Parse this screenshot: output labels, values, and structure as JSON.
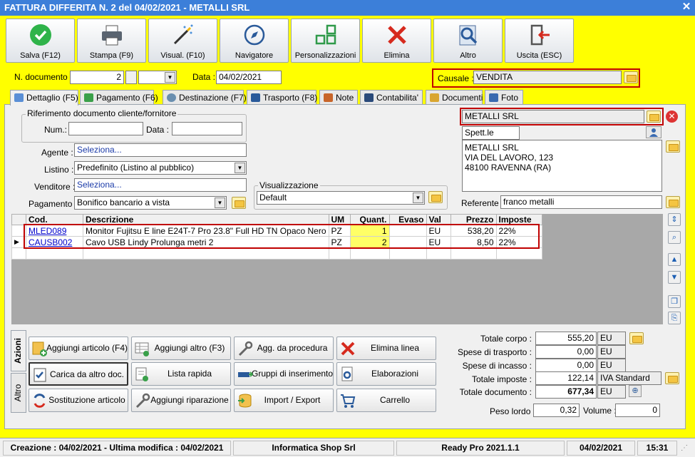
{
  "window": {
    "title": "FATTURA DIFFERITA N. 2 del 04/02/2021 - METALLI SRL",
    "close": "✕"
  },
  "toolbar": [
    {
      "label": "Salva (F12)",
      "icon": "save-check-icon"
    },
    {
      "label": "Stampa (F9)",
      "icon": "printer-icon"
    },
    {
      "label": "Visual. (F10)",
      "icon": "magic-wand-icon"
    },
    {
      "label": "Navigatore",
      "icon": "compass-icon"
    },
    {
      "label": "Personalizzazioni",
      "icon": "grid-icon"
    },
    {
      "label": "Elimina",
      "icon": "delete-x-icon"
    },
    {
      "label": "Altro",
      "icon": "magnifier-icon"
    },
    {
      "label": "Uscita (ESC)",
      "icon": "exit-door-icon"
    }
  ],
  "header": {
    "ndoc_label": "N. documento :",
    "ndoc_value": "2",
    "data_label": "Data :",
    "data_value": "04/02/2021",
    "causale_label": "Causale :",
    "causale_value": "VENDITA"
  },
  "tabs": [
    "Dettaglio (F5)",
    "Pagamento (F6)",
    "Destinazione (F7)",
    "Trasporto (F8)",
    "Note",
    "Contabilita'",
    "Documenti",
    "Foto"
  ],
  "form": {
    "rif_title": "Riferimento documento cliente/fornitore",
    "num_label": "Num.:",
    "data_label": "Data :",
    "agente_label": "Agente :",
    "agente_value": "Seleziona...",
    "listino_label": "Listino :",
    "listino_value": "Predefinito (Listino al pubblico)",
    "venditore_label": "Venditore :",
    "venditore_value": "Seleziona...",
    "pagamento_label": "Pagamento :",
    "pagamento_value": "Bonifico bancario a vista",
    "visual_title": "Visualizzazione",
    "visual_value": "Default"
  },
  "customer": {
    "name": "METALLI SRL",
    "title": "Spett.le",
    "address_lines": [
      "METALLI SRL",
      "VIA DEL LAVORO, 123",
      "48100 RAVENNA (RA)"
    ],
    "referente_label": "Referente",
    "referente_value": "franco metalli"
  },
  "grid": {
    "headers": [
      "Cod.",
      "Descrizione",
      "UM",
      "Quant.",
      "Evaso",
      "Val",
      "Prezzo",
      "Imposte"
    ],
    "rows": [
      {
        "cod": "MLED089",
        "desc": "Monitor Fujitsu E line E24T-7 Pro 23.8\" Full HD TN Opaco Nero",
        "um": "PZ",
        "qty": "1",
        "evaso": "",
        "val": "EU",
        "prezzo": "538,20",
        "imposte": "22%"
      },
      {
        "cod": "CAUSB002",
        "desc": "Cavo USB Lindy Prolunga metri 2",
        "um": "PZ",
        "qty": "2",
        "evaso": "",
        "val": "EU",
        "prezzo": "8,50",
        "imposte": "22%"
      }
    ]
  },
  "actions": {
    "vtab_azioni": "Azioni",
    "vtab_altro": "Altro",
    "buttons": [
      "Aggiungi articolo (F4)",
      "Aggiungi altro (F3)",
      "Agg. da procedura",
      "Elimina linea",
      "Carica da altro doc.",
      "Lista rapida",
      "Gruppi di inserimento",
      "Elaborazioni",
      "Sostituzione articolo",
      "Aggiungi riparazione",
      "Import / Export",
      "Carrello"
    ]
  },
  "totals": {
    "totale_corpo_label": "Totale corpo :",
    "totale_corpo": "555,20",
    "trasporto_label": "Spese di trasporto :",
    "trasporto": "0,00",
    "incasso_label": "Spese di incasso :",
    "incasso": "0,00",
    "imposte_label": "Totale imposte :",
    "imposte": "122,14",
    "iva": "IVA Standard",
    "documento_label": "Totale documento :",
    "documento": "677,34",
    "currency": "EU",
    "peso_label": "Peso lordo :",
    "peso": "0,32",
    "volume_label": "Volume :",
    "volume": "0"
  },
  "statusbar": {
    "dates": "Creazione : 04/02/2021 - Ultima modifica : 04/02/2021",
    "company": "Informatica Shop Srl",
    "version": "Ready Pro 2021.1.1",
    "date": "04/02/2021",
    "time": "15:31"
  }
}
